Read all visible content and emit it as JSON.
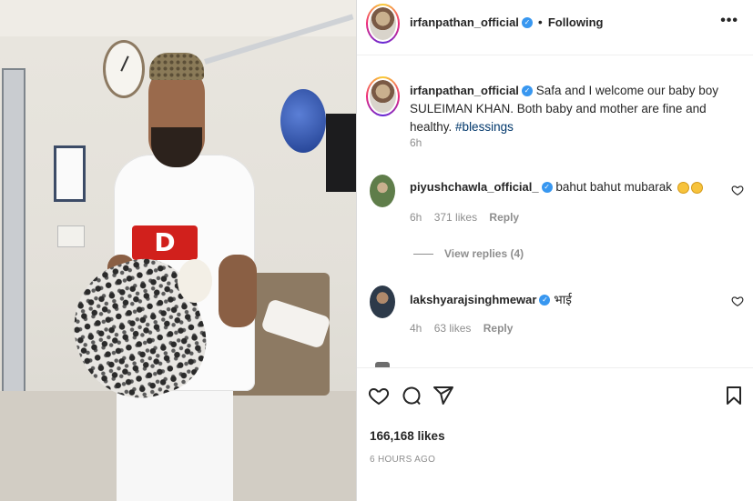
{
  "post": {
    "author": "irfanpathan_official",
    "follow_status": "Following",
    "more_icon": "more-horizontal-icon",
    "caption": {
      "author": "irfanpathan_official",
      "text": "Safa and I welcome our baby boy SULEIMAN KHAN. Both baby and mother are fine and healthy.",
      "hashtag": "#blessings",
      "time": "6h"
    },
    "comments": [
      {
        "author": "piyushchawla_official_",
        "text": "bahut bahut mubarak",
        "time": "6h",
        "likes": "371 likes",
        "reply": "Reply",
        "view_replies": "View replies (4)"
      },
      {
        "author": "lakshyarajsinghmewar",
        "text": "भाई",
        "time": "4h",
        "likes": "63 likes",
        "reply": "Reply"
      }
    ],
    "actions": [
      "heart-icon",
      "comment-icon",
      "share-icon",
      "bookmark-icon"
    ],
    "likes_count": "166,168 likes",
    "posted_ago": "6 HOURS AGO"
  },
  "colors": {
    "verified": "#3897f0",
    "hashtag": "#00376b",
    "muted": "#8e8e8e"
  }
}
